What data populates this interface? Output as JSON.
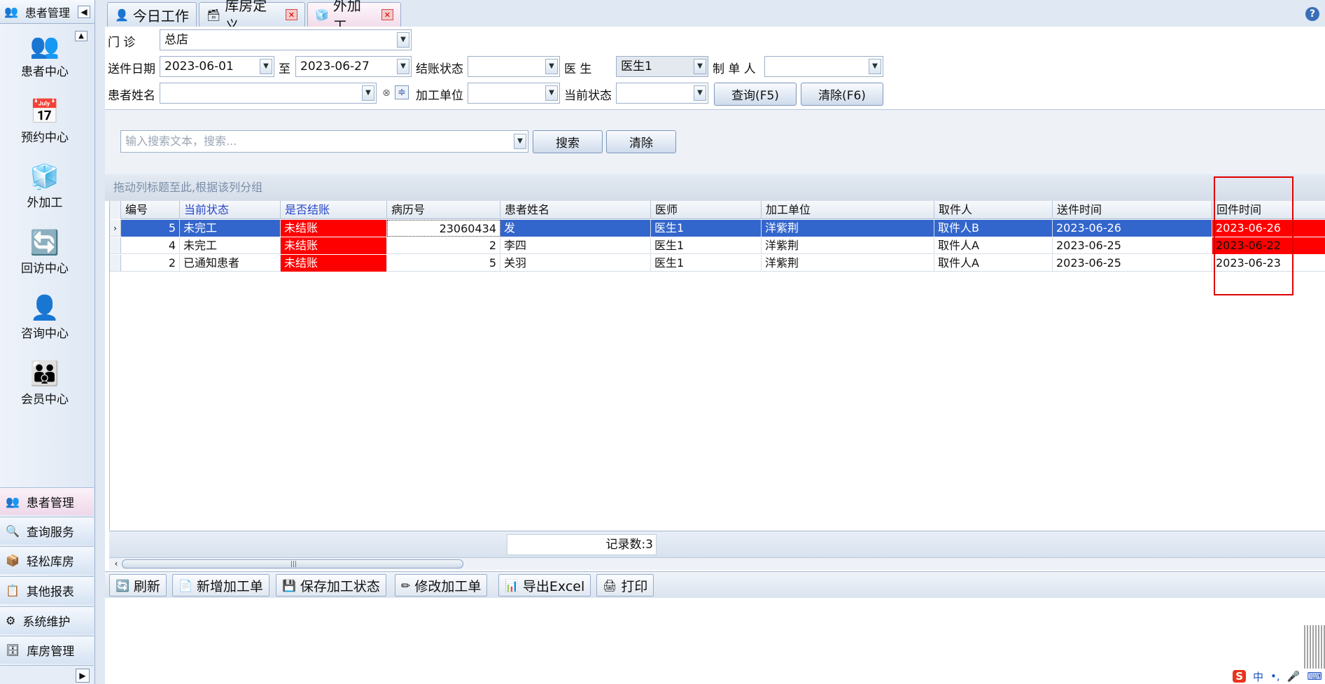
{
  "sidebar": {
    "header_label": "患者管理",
    "items": [
      {
        "label": "患者中心",
        "icon": "binoculars-icon",
        "glyph": "👥"
      },
      {
        "label": "预约中心",
        "icon": "calendar-icon",
        "glyph": "📅"
      },
      {
        "label": "外加工",
        "icon": "cubes-icon",
        "glyph": "🧊"
      },
      {
        "label": "回访中心",
        "icon": "refresh-icon",
        "glyph": "🔄"
      },
      {
        "label": "咨询中心",
        "icon": "consult-icon",
        "glyph": "👤"
      },
      {
        "label": "会员中心",
        "icon": "members-icon",
        "glyph": "👪"
      }
    ],
    "nav": [
      {
        "label": "患者管理",
        "icon": "patients-icon",
        "glyph": "👥"
      },
      {
        "label": "查询服务",
        "icon": "query-icon",
        "glyph": "🔍"
      },
      {
        "label": "轻松库房",
        "icon": "warehouse-icon",
        "glyph": "📦"
      },
      {
        "label": "其他报表",
        "icon": "report-icon",
        "glyph": "📋"
      },
      {
        "label": "系统维护",
        "icon": "gear-icon",
        "glyph": "⚙"
      },
      {
        "label": "库房管理",
        "icon": "storage-icon",
        "glyph": "🗄"
      }
    ]
  },
  "tabs": [
    {
      "label": "今日工作",
      "glyph": "👤"
    },
    {
      "label": "库房定义",
      "glyph": "🗃"
    },
    {
      "label": "外加工",
      "glyph": "🧊"
    }
  ],
  "filters": {
    "clinic_label": "门    诊",
    "clinic_value": "总店",
    "send_date_label": "送件日期",
    "date_from": "2023-06-01",
    "to_label": "至",
    "date_to": "2023-06-27",
    "settle_label": "结账状态",
    "settle_value": "",
    "doctor_label": "医    生",
    "doctor_value": "医生1",
    "maker_label": "制 单 人",
    "maker_value": "",
    "patient_label": "患者姓名",
    "patient_value": "",
    "unit_label": "加工单位",
    "unit_value": "",
    "status_label": "当前状态",
    "status_value": "",
    "query_button": "查询(F5)",
    "clear_button": "清除(F6)"
  },
  "search": {
    "placeholder": "输入搜索文本，搜索...",
    "search_button": "搜索",
    "clear_button": "清除"
  },
  "group_hint": "拖动列标题至此,根据该列分组",
  "grid": {
    "columns": [
      "编号",
      "当前状态",
      "是否结账",
      "病历号",
      "患者姓名",
      "医师",
      "加工单位",
      "取件人",
      "送件时间",
      "回件时间"
    ],
    "rows": [
      {
        "id": "5",
        "status": "未完工",
        "settled": "未结账",
        "record_no": "23060434",
        "patient": "发",
        "doctor": "医生1",
        "unit": "洋紫荆",
        "picker": "取件人B",
        "send_time": "2023-06-26",
        "return_time": "2023-06-26"
      },
      {
        "id": "4",
        "status": "未完工",
        "settled": "未结账",
        "record_no": "2",
        "patient": "李四",
        "doctor": "医生1",
        "unit": "洋紫荆",
        "picker": "取件人A",
        "send_time": "2023-06-25",
        "return_time": "2023-06-22"
      },
      {
        "id": "2",
        "status": "已通知患者",
        "settled": "未结账",
        "record_no": "5",
        "patient": "关羽",
        "doctor": "医生1",
        "unit": "洋紫荆",
        "picker": "取件人A",
        "send_time": "2023-06-25",
        "return_time": "2023-06-23"
      }
    ]
  },
  "record_count": "记录数:3",
  "toolbar": [
    {
      "label": "刷新",
      "glyph": "🔄"
    },
    {
      "label": "新增加工单",
      "glyph": "📄"
    },
    {
      "label": "保存加工状态",
      "glyph": "💾"
    },
    {
      "label": "修改加工单",
      "glyph": "✏"
    },
    {
      "label": "导出Excel",
      "glyph": "📊"
    },
    {
      "label": "打印",
      "glyph": "🖨"
    }
  ],
  "colors": {
    "selected_row": "#3366cc",
    "unsettled": "#ff0000",
    "highlight_box": "#e00000"
  }
}
